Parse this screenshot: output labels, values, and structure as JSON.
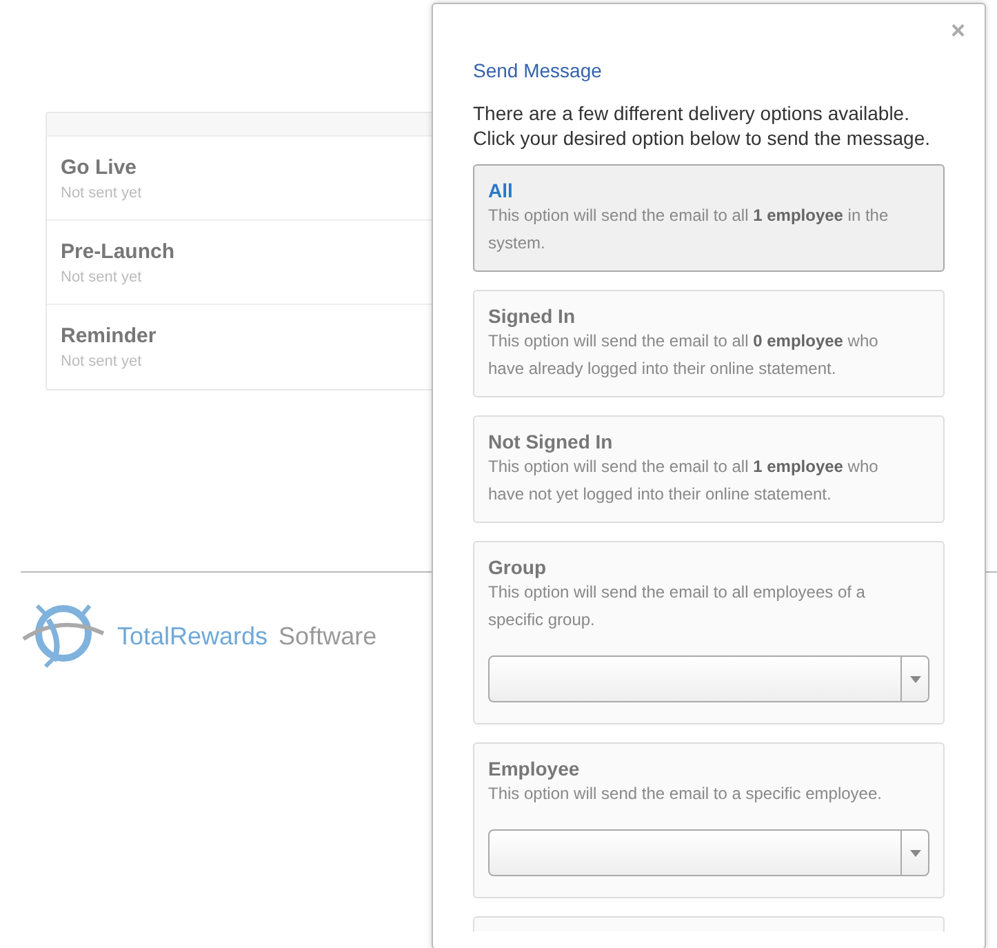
{
  "messages": [
    {
      "title": "Go Live",
      "status": "Not sent yet"
    },
    {
      "title": "Pre-Launch",
      "status": "Not sent yet"
    },
    {
      "title": "Reminder",
      "status": "Not sent yet"
    }
  ],
  "logo": {
    "brand": "TotalRewards",
    "suffix": "Software"
  },
  "dialog": {
    "close": "×",
    "title": "Send Message",
    "intro": "There are a few different delivery options available. Click your desired option below to send the message.",
    "options": [
      {
        "kind": "plain",
        "title": "All",
        "description": "This option will send the email to all **1 employee** in the system.",
        "selected": true
      },
      {
        "kind": "plain",
        "title": "Signed In",
        "description": "This option will send the email to all **0 employee** who have already logged into their online statement.",
        "selected": false
      },
      {
        "kind": "plain",
        "title": "Not Signed In",
        "description": "This option will send the email to all **1 employee** who have not yet logged into their online statement.",
        "selected": false
      },
      {
        "kind": "select",
        "title": "Group",
        "description": "This option will send the email to all employees of a specific group.",
        "selected": false
      },
      {
        "kind": "select",
        "title": "Employee",
        "description": "This option will send the email to a specific employee.",
        "selected": false
      }
    ]
  }
}
